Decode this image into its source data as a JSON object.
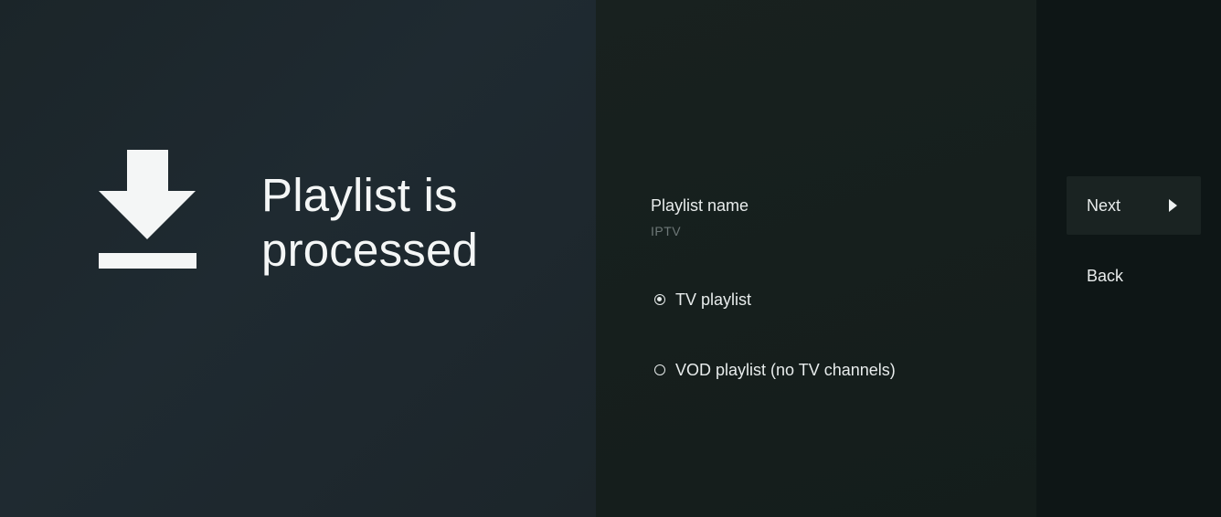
{
  "left": {
    "title_line1": "Playlist is",
    "title_line2": "processed",
    "icon": "download-icon"
  },
  "form": {
    "playlist_name_label": "Playlist name",
    "playlist_name_value": "IPTV",
    "options": [
      {
        "label": "TV playlist",
        "checked": true
      },
      {
        "label": "VOD playlist (no TV channels)",
        "checked": false
      }
    ]
  },
  "actions": {
    "next_label": "Next",
    "back_label": "Back"
  },
  "colors": {
    "left_bg": "#1f2a31",
    "middle_bg": "#161f1d",
    "right_bg": "#0e1616",
    "text": "#e8ecec",
    "muted_text": "#6e7878",
    "focused_button_bg": "#1a2322"
  }
}
